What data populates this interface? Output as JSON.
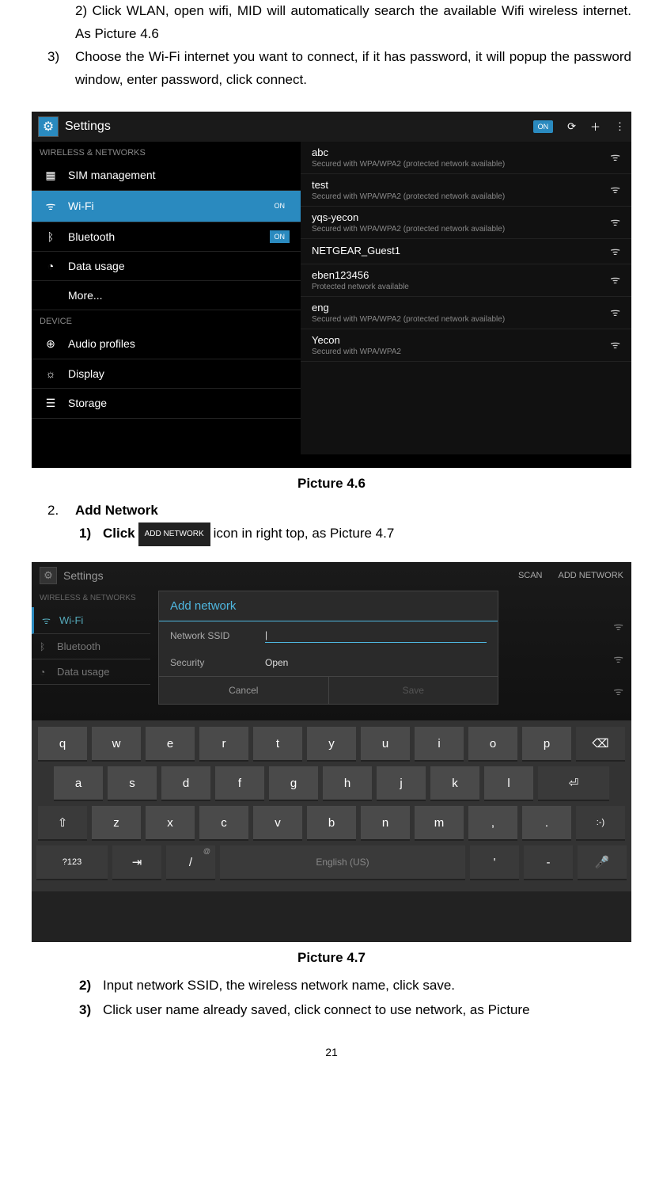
{
  "intro_text": "2) Click WLAN, open wifi, MID will automatically search the available Wifi wireless internet. As Picture 4.6",
  "step3_num": "3)",
  "step3_text": "Choose the Wi-Fi internet you want to connect, if it has password, it will popup the password window, enter password, click connect.",
  "caption1": "Picture 4.6",
  "section2_num": "2.",
  "section2_title": "Add Network",
  "sub1_num": "1)",
  "sub1_a": "Click",
  "sub1_btn": "ADD NETWORK",
  "sub1_b": "icon in right top, as Picture 4.7",
  "caption2": "Picture 4.7",
  "sub2_num": "2)",
  "sub2_text": "Input network SSID, the wireless network name, click save.",
  "sub3_num": "3)",
  "sub3_text": "Click user name already saved, click connect to use network, as Picture",
  "page_number": "21",
  "shot1": {
    "title": "Settings",
    "toggle": "ON",
    "left_section1": "WIRELESS & NETWORKS",
    "left_section2": "DEVICE",
    "left_items": [
      {
        "icon": "▦",
        "label": "SIM management",
        "toggle": ""
      },
      {
        "icon": "ᯤ",
        "label": "Wi-Fi",
        "toggle": "ON",
        "sel": true
      },
      {
        "icon": "ᛒ",
        "label": "Bluetooth",
        "toggle": "ON"
      },
      {
        "icon": "◔",
        "label": "Data usage",
        "toggle": ""
      },
      {
        "icon": "",
        "label": "More...",
        "toggle": ""
      }
    ],
    "device_items": [
      {
        "icon": "⊕",
        "label": "Audio profiles"
      },
      {
        "icon": "☼",
        "label": "Display"
      },
      {
        "icon": "☰",
        "label": "Storage"
      }
    ],
    "networks": [
      {
        "name": "abc",
        "sub": "Secured with WPA/WPA2 (protected network available)"
      },
      {
        "name": "test",
        "sub": "Secured with WPA/WPA2 (protected network available)"
      },
      {
        "name": "yqs-yecon",
        "sub": "Secured with WPA/WPA2 (protected network available)"
      },
      {
        "name": "NETGEAR_Guest1",
        "sub": ""
      },
      {
        "name": "eben123456",
        "sub": "Protected network available"
      },
      {
        "name": "eng",
        "sub": "Secured with WPA/WPA2 (protected network available)"
      },
      {
        "name": "Yecon",
        "sub": "Secured with WPA/WPA2"
      }
    ]
  },
  "shot2": {
    "title": "Settings",
    "scan": "SCAN",
    "add": "ADD NETWORK",
    "left_section": "WIRELESS & NETWORKS",
    "left_items": [
      {
        "icon": "ᯤ",
        "label": "Wi-Fi",
        "sel": true
      },
      {
        "icon": "ᛒ",
        "label": "Bluetooth"
      },
      {
        "icon": "◔",
        "label": "Data usage"
      }
    ],
    "dialog": {
      "title": "Add network",
      "ssid_label": "Network SSID",
      "ssid_value": "|",
      "sec_label": "Security",
      "sec_value": "Open",
      "cancel": "Cancel",
      "save": "Save"
    },
    "keyboard": {
      "row1": [
        "q",
        "w",
        "e",
        "r",
        "t",
        "y",
        "u",
        "i",
        "o",
        "p"
      ],
      "row2": [
        "a",
        "s",
        "d",
        "f",
        "g",
        "h",
        "j",
        "k",
        "l"
      ],
      "row3": [
        "z",
        "x",
        "c",
        "v",
        "b",
        "n",
        "m",
        ",",
        "."
      ],
      "space": "English (US)",
      "num": "?123"
    }
  }
}
